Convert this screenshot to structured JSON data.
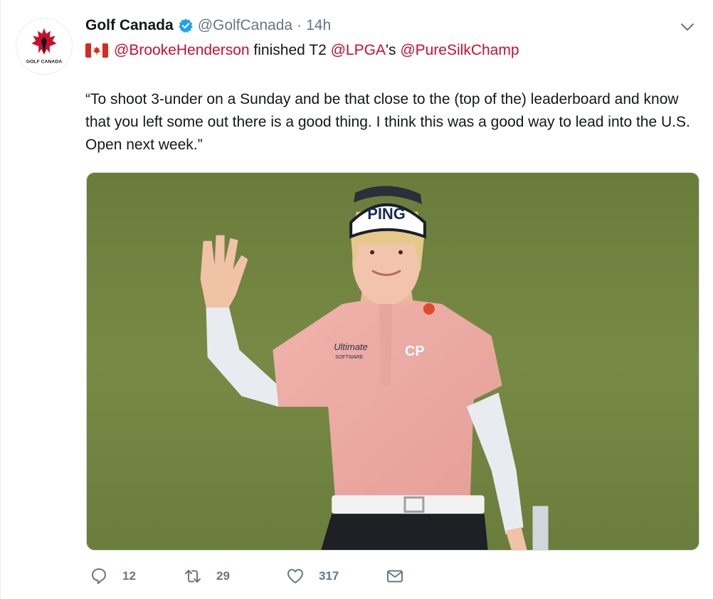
{
  "account": {
    "display_name": "Golf Canada",
    "handle": "@GolfCanada",
    "separator": "·",
    "time": "14h",
    "verified": true,
    "avatar_text": "GOLF CANADA"
  },
  "tweet": {
    "flag_icon": "canada-flag-icon",
    "line1": [
      {
        "text": "@BrookeHenderson",
        "type": "mention"
      },
      {
        "text": " finished T2 ",
        "type": "plain"
      },
      {
        "text": "@LPGA",
        "type": "mention"
      },
      {
        "text": "'s ",
        "type": "plain"
      },
      {
        "text": "@PureSilkChamp",
        "type": "mention"
      }
    ],
    "quote": "“To shoot 3-under on a Sunday and be that close to the (top of the) leaderboard and know that you left some out there is a good thing. I think this was a good way to lead into the U.S. Open next week.”"
  },
  "media": {
    "visor_text": "PING",
    "shirt_logo_text": "Ultimate",
    "shirt_logo_sub": "SOFTWARE",
    "sleeve_text": "CP"
  },
  "actions": {
    "reply_count": "12",
    "retweet_count": "29",
    "like_count": "317"
  },
  "colors": {
    "mention": "#c8102e",
    "secondary": "#657786",
    "verified": "#1da1f2",
    "grass": "#6b7d3e"
  }
}
